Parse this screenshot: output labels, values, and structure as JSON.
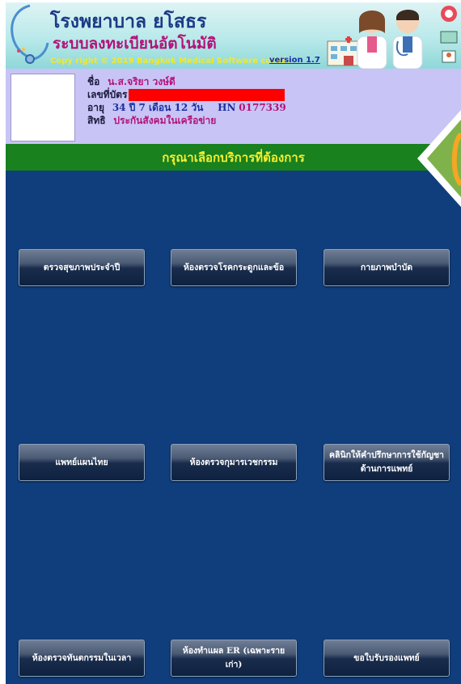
{
  "header": {
    "title": "โรงพยาบาล ยโสธร",
    "subtitle": "ระบบลงทะเบียนอัตโนมัติ",
    "copyright": "Copy right © 2019 Bangkok Medical Software co.ltd.",
    "version": "version 1.7"
  },
  "patient": {
    "name_label": "ชื่อ",
    "name_value": "น.ส.จริยา วงษ์ดี",
    "card_label": "เลขที่บัตร",
    "age_label": "อายุ",
    "age_value": "34 ปี 7 เดือน 12 วัน",
    "hn_label": "HN",
    "hn_value": "0177339",
    "right_label": "สิทธิ",
    "right_value": "ประกันสังคมในเครือข่าย"
  },
  "prompt": "กรุณาเลือกบริการที่ต้องการ",
  "services": [
    {
      "label": "ตรวจสุขภาพประจำปี"
    },
    {
      "label": "ห้องตรวจโรคกระดูกและข้อ"
    },
    {
      "label": "กายภาพบำบัด"
    },
    {
      "label": "แพทย์แผนไทย"
    },
    {
      "label": "ห้องตรวจกุมารเวชกรรม"
    },
    {
      "label": "คลินิกให้คำปรึกษาการใช้กัญชาด้านการแพทย์"
    },
    {
      "label": "ห้องตรวจทันตกรรมในเวลา"
    },
    {
      "label": "ห้องทำแผล ER (เฉพาะรายเก่า)"
    },
    {
      "label": "ขอใบรับรองแพทย์"
    }
  ],
  "colors": {
    "main_bg": "#103e7c",
    "prompt_bar": "#19811e",
    "patient_panel": "#c8c4f6",
    "redacted": "#ff0000"
  },
  "icons": [
    "stethoscope-icon",
    "doctor-illustration",
    "hospital-building-icon",
    "monitor-icon",
    "phone-icon"
  ]
}
